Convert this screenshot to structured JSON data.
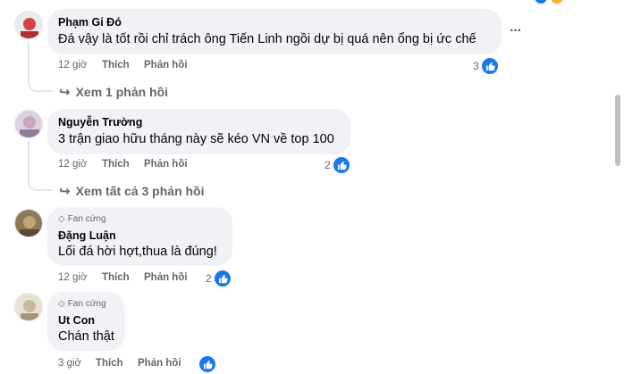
{
  "comments": [
    {
      "author": "Phạm Gi Đó",
      "badge": "",
      "text": "Đá vậy là tốt rồi chỉ trách ông Tiến Linh ngồi dự bị quá nên ổng bị ức chế",
      "time": "12 giờ",
      "like_label": "Thích",
      "reply_label": "Phản hồi",
      "reactions": "3",
      "view_replies": "Xem 1 phản hồi"
    },
    {
      "author": "Nguyễn Trường",
      "badge": "",
      "text": "3 trận giao hữu tháng này sẽ kéo VN về top 100",
      "time": "12 giờ",
      "like_label": "Thích",
      "reply_label": "Phản hồi",
      "reactions": "2",
      "view_replies": "Xem tất cả 3 phản hồi"
    },
    {
      "author": "Đặng Luận",
      "badge": "Fan cứng",
      "text": "Lối đá hời hợt,thua là đúng!",
      "time": "12 giờ",
      "like_label": "Thích",
      "reply_label": "Phản hồi",
      "reactions": "2"
    },
    {
      "author": "Ut Con",
      "badge": "Fan cứng",
      "text": "Chán thật",
      "time": "3 giờ",
      "like_label": "Thích",
      "reply_label": "Phản hồi",
      "reactions": ""
    }
  ],
  "more_options": "···",
  "colors": {
    "like_blue": "#1877f2",
    "bubble": "#f0f2f5",
    "meta": "#65676b"
  }
}
